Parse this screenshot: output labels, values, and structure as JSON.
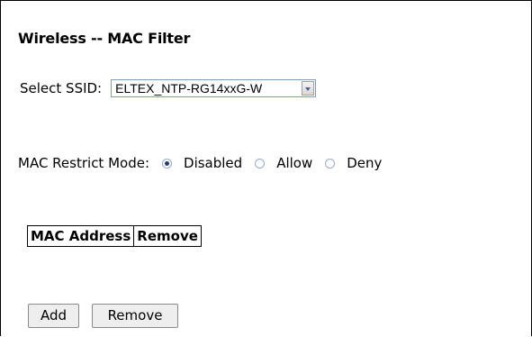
{
  "page": {
    "title": "Wireless -- MAC Filter"
  },
  "ssid": {
    "label": "Select SSID:",
    "selected": "ELTEX_NTP-RG14xxG-W"
  },
  "mac_restrict": {
    "label": "MAC Restrict Mode:",
    "options": [
      {
        "label": "Disabled",
        "checked": true
      },
      {
        "label": "Allow",
        "checked": false
      },
      {
        "label": "Deny",
        "checked": false
      }
    ]
  },
  "table": {
    "columns": [
      "MAC Address",
      "Remove"
    ]
  },
  "buttons": {
    "add": "Add",
    "remove": "Remove"
  }
}
